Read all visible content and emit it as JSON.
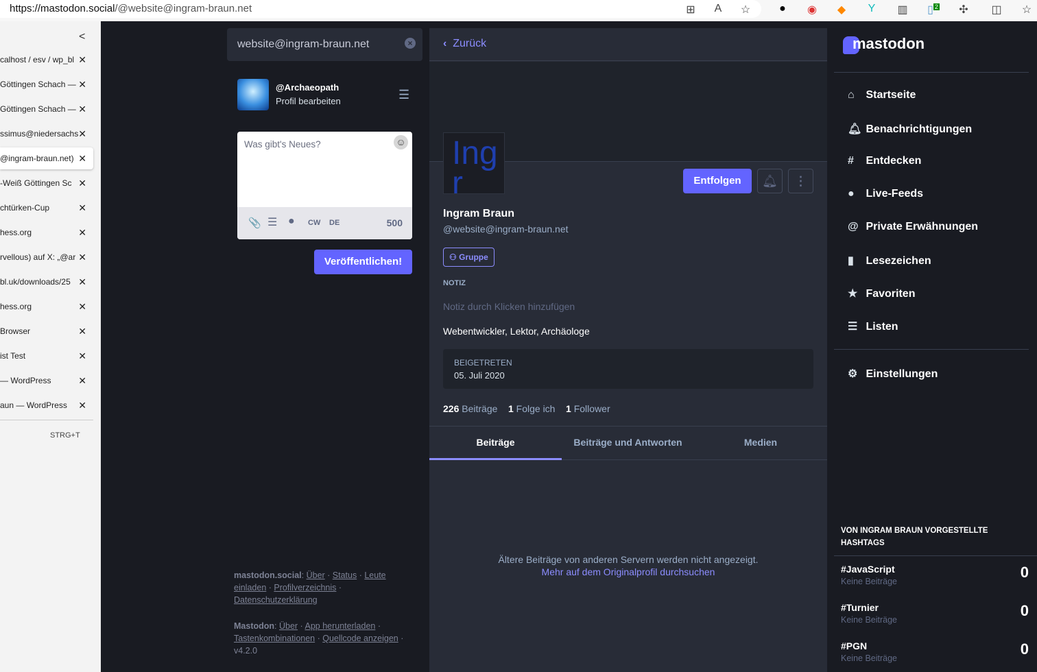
{
  "browser": {
    "url_host": "https://mastodon.social",
    "url_path": "/@website@ingram-braun.net",
    "extension_badge": "2"
  },
  "tabs": [
    {
      "title": "calhost / esv / wp_bl"
    },
    {
      "title": "Göttingen Schach —"
    },
    {
      "title": "Göttingen Schach —"
    },
    {
      "title": "ssimus@niedersachs"
    },
    {
      "title": "@ingram-braun.net)",
      "active": true
    },
    {
      "title": "-Weiß Göttingen Sc"
    },
    {
      "title": "chtürken-Cup"
    },
    {
      "title": "hess.org"
    },
    {
      "title": "rvellous) auf X: „@ar"
    },
    {
      "title": "bl.uk/downloads/25"
    },
    {
      "title": "hess.org"
    },
    {
      "title": " Browser"
    },
    {
      "title": "ist Test"
    },
    {
      "title": "— WordPress"
    },
    {
      "title": "aun — WordPress"
    }
  ],
  "new_tab_shortcut": "STRG+T",
  "search": {
    "value": "website@ingram-braun.net"
  },
  "me": {
    "handle": "@Archaeopath",
    "edit": "Profil bearbeiten"
  },
  "compose": {
    "placeholder": "Was gibt's Neues?",
    "cw": "CW",
    "lang": "DE",
    "count": "500",
    "publish": "Veröffentlichen!"
  },
  "footer": {
    "server": "mastodon.social",
    "about": "Über",
    "status": "Status",
    "invite": "Leute einladen",
    "directory": "Profilverzeichnis",
    "privacy": "Datenschutzerklärung",
    "app": "Mastodon",
    "about2": "Über",
    "download": "App herunterladen",
    "shortcuts": "Tastenkombinationen",
    "source": "Quellcode anzeigen",
    "version": "v4.2.0"
  },
  "profile": {
    "back": "Zurück",
    "avatar_text": "Ingr Bra",
    "name": "Ingram Braun",
    "acct": "@website@ingram-braun.net",
    "unfollow": "Entfolgen",
    "badge": "Gruppe",
    "note_label": "NOTIZ",
    "note_placeholder": "Notiz durch Klicken hinzufügen",
    "bio": "Webentwickler, Lektor, Archäologe",
    "joined_label": "BEIGETRETEN",
    "joined": "05. Juli 2020",
    "stats": [
      {
        "n": "226",
        "l": "Beiträge"
      },
      {
        "n": "1",
        "l": "Folge ich"
      },
      {
        "n": "1",
        "l": "Follower"
      }
    ],
    "tabs": [
      "Beiträge",
      "Beiträge und Antworten",
      "Medien"
    ],
    "notice": "Ältere Beiträge von anderen Servern werden nicht angezeigt.",
    "notice_link": "Mehr auf dem Originalprofil durchsuchen"
  },
  "logo": "mastodon",
  "nav": [
    {
      "icon": "home",
      "label": "Startseite"
    },
    {
      "icon": "bell",
      "label": "Benachrichtigungen"
    },
    {
      "icon": "hashtag",
      "label": "Entdecken"
    },
    {
      "icon": "globe",
      "label": "Live-Feeds"
    },
    {
      "icon": "at",
      "label": "Private Erwähnungen"
    },
    {
      "icon": "bookmark",
      "label": "Lesezeichen"
    },
    {
      "icon": "star",
      "label": "Favoriten"
    },
    {
      "icon": "list",
      "label": "Listen"
    },
    {
      "icon": "gear",
      "label": "Einstellungen"
    }
  ],
  "featured": {
    "title": "VON INGRAM BRAUN VORGESTELLTE HASHTAGS",
    "items": [
      {
        "tag": "#JavaScript",
        "sub": "Keine Beiträge",
        "count": "0"
      },
      {
        "tag": "#Turnier",
        "sub": "Keine Beiträge",
        "count": "0"
      },
      {
        "tag": "#PGN",
        "sub": "Keine Beiträge",
        "count": "0"
      }
    ]
  },
  "colors": {
    "accent": "#6364ff",
    "link": "#8c8dff",
    "bg": "#191b22",
    "column": "#282c37"
  }
}
